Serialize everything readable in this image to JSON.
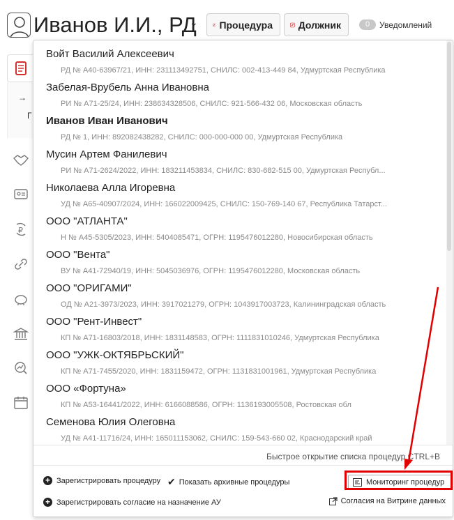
{
  "header": {
    "user_name": "Иванов И.И., РД",
    "caret": "⌄",
    "procedure_button": "Процедура",
    "debtor_button": "Должник",
    "notifications_count": "0",
    "notifications_label": "Уведомлений"
  },
  "procedure_list": [
    {
      "name": "Войт Василий Алексеевич",
      "details": "РД № А40-63967/21, ИНН: 231113492751, СНИЛС: 002-413-449 84, Удмуртская Республика",
      "active": false
    },
    {
      "name": "Забелая-Врубель Анна Ивановна",
      "details": "РИ № А71-25/24, ИНН: 238634328506, СНИЛС: 921-566-432 06, Московская область",
      "active": false
    },
    {
      "name": "Иванов Иван Иванович",
      "details": "РД № 1, ИНН: 892082438282, СНИЛС: 000-000-000 00, Удмуртская Республика",
      "active": true
    },
    {
      "name": "Мусин Артем Фанилевич",
      "details": "РИ № А71-2624/2022, ИНН: 183211453834, СНИЛС: 830-682-515 00, Удмуртская Республ...",
      "active": false
    },
    {
      "name": "Николаева Алла Игоревна",
      "details": "УД № А65-40907/2024, ИНН: 166022009425, СНИЛС: 150-769-140 67, Республика Татарст...",
      "active": false
    },
    {
      "name": "ООО \"АТЛАНТА\"",
      "details": "Н № А45-5305/2023, ИНН: 5404085471, ОГРН: 1195476012280, Новосибирская область",
      "active": false
    },
    {
      "name": "ООО \"Вента\"",
      "details": "ВУ № А41-72940/19, ИНН: 5045036976, ОГРН: 1195476012280, Московская область",
      "active": false
    },
    {
      "name": "ООО \"ОРИГАМИ\"",
      "details": "ОД № А21-3973/2023, ИНН: 3917021279, ОГРН: 1043917003723, Калининградская область",
      "active": false
    },
    {
      "name": "ООО \"Рент-Инвест\"",
      "details": "КП № А71-16803/2018, ИНН: 1831148583, ОГРН: 1111831010246, Удмуртская Республика",
      "active": false
    },
    {
      "name": "ООО \"УЖК-ОКТЯБРЬСКИЙ\"",
      "details": "КП № А71-7455/2020, ИНН: 1831159472, ОГРН: 1131831001961, Удмуртская Республика",
      "active": false
    },
    {
      "name": "ООО «Фортуна»",
      "details": "КП № А53-16441/2022, ИНН: 6166088586, ОГРН: 1136193005508, Ростовская обл",
      "active": false
    },
    {
      "name": "Семенова Юлия Олеговна",
      "details": "УД № А41-11716/24, ИНН: 165011153062, СНИЛС: 159-543-660 02, Краснодарский край",
      "active": false
    }
  ],
  "footer": {
    "quick_open_hint": "Быстрое открытие списка процедур CTRL+B",
    "register_procedure": "Зарегистрировать процедуру",
    "show_archived": "Показать архивные процедуры",
    "monitoring": "Мониторинг процедур",
    "register_consent": "Зарегистрировать согласие на назначение АУ",
    "vitrine_consents": "Согласия на Витрине данных"
  },
  "colors": {
    "accent_red": "#d32f2f",
    "annotation_red": "#e00000",
    "detail_gray": "#8a8a8a"
  },
  "icons": [
    "user-avatar-icon",
    "pencil-icon",
    "handshake-icon",
    "id-card-icon",
    "ruble-refresh-icon",
    "link-icon",
    "piggy-bank-icon",
    "bank-icon",
    "chart-icon",
    "calendar-icon",
    "monitoring-icon",
    "external-link-icon"
  ]
}
